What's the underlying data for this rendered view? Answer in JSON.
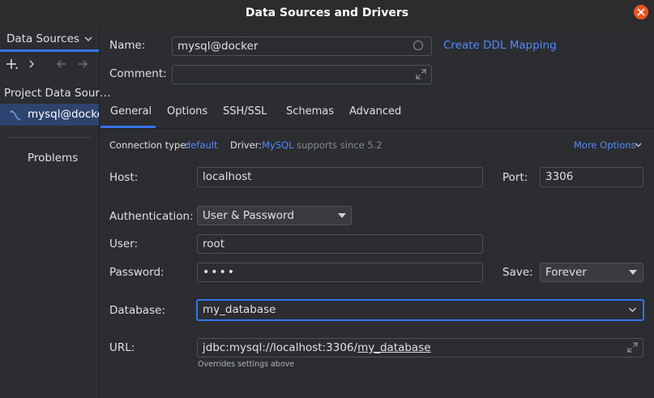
{
  "window": {
    "title": "Data Sources and Drivers"
  },
  "left": {
    "header": "Data Sources",
    "section": "Project Data Sour…",
    "items": [
      {
        "label": "mysql@docker"
      }
    ],
    "problems": "Problems"
  },
  "form": {
    "name_label": "Name:",
    "name_value": "mysql@docker",
    "ddl_link": "Create DDL Mapping",
    "comment_label": "Comment:",
    "comment_value": "",
    "tabs": [
      "General",
      "Options",
      "SSH/SSL",
      "Schemas",
      "Advanced"
    ],
    "conn_type_label": "Connection type:",
    "conn_type_value": "default",
    "driver_label": "Driver:",
    "driver_value": "MySQL",
    "driver_note": "supports since 5.2",
    "more_options": "More Options",
    "host_label": "Host:",
    "host_value": "localhost",
    "port_label": "Port:",
    "port_value": "3306",
    "auth_label": "Authentication:",
    "auth_value": "User & Password",
    "user_label": "User:",
    "user_value": "root",
    "password_label": "Password:",
    "password_value": "••••",
    "save_label": "Save:",
    "save_value": "Forever",
    "database_label": "Database:",
    "database_value": "my_database",
    "url_label": "URL:",
    "url_prefix": "jdbc:mysql://localhost:3306/",
    "url_db": "my_database",
    "url_hint": "Overrides settings above"
  },
  "colors": {
    "accent": "#3574f0",
    "link": "#548af7",
    "selection": "#2e436e",
    "close": "#e95420"
  }
}
